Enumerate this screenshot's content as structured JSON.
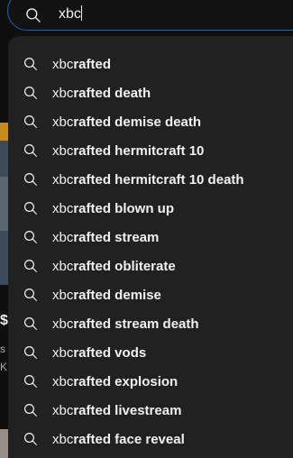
{
  "search": {
    "query": "xbc"
  },
  "suggestions": [
    {
      "typed": "xbc",
      "rest": "rafted"
    },
    {
      "typed": "xbc",
      "rest": "rafted death"
    },
    {
      "typed": "xbc",
      "rest": "rafted demise death"
    },
    {
      "typed": "xbc",
      "rest": "rafted hermitcraft 10"
    },
    {
      "typed": "xbc",
      "rest": "rafted hermitcraft 10 death"
    },
    {
      "typed": "xbc",
      "rest": "rafted blown up"
    },
    {
      "typed": "xbc",
      "rest": "rafted stream"
    },
    {
      "typed": "xbc",
      "rest": "rafted obliterate"
    },
    {
      "typed": "xbc",
      "rest": "rafted demise"
    },
    {
      "typed": "xbc",
      "rest": "rafted stream death"
    },
    {
      "typed": "xbc",
      "rest": "rafted vods"
    },
    {
      "typed": "xbc",
      "rest": "rafted explosion"
    },
    {
      "typed": "xbc",
      "rest": "rafted livestream"
    },
    {
      "typed": "xbc",
      "rest": "rafted face reveal"
    }
  ],
  "background": {
    "price_glyph": "$",
    "letter_s": "s",
    "letter_k": "K"
  },
  "colors": {
    "accent_border": "#1c62b9",
    "dropdown_bg": "#212121",
    "text": "#f1f1f1"
  }
}
